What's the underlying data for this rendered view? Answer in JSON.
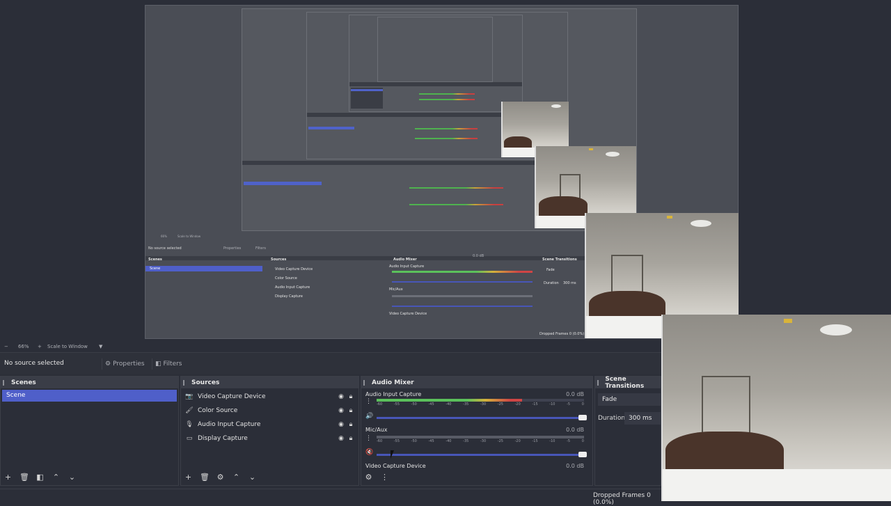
{
  "preview": {
    "nested_labels": {
      "no_source": "No source selected",
      "properties": "Properties",
      "filters": "Filters",
      "scenes": "Scenes",
      "scene": "Scene",
      "sources": "Sources",
      "mixer": "Audio Mixer",
      "transitions": "Scene Transitions",
      "zoom": "66%",
      "scale": "Scale to Window",
      "fade": "Fade",
      "duration": "Duration",
      "duration_val": "300 ms",
      "frames": "Dropped Frames 0 (0.0%)",
      "src1": "Video Capture Device",
      "src2": "Color Source",
      "src3": "Audio Input Capture",
      "src4": "Display Capture",
      "aic": "Audio Input Capture",
      "mic": "Mic/Aux",
      "vcd": "Video Capture Device",
      "db": "0.0 dB"
    }
  },
  "toolbar": {
    "zoom_minus": "−",
    "zoom_value": "66%",
    "zoom_plus": "+",
    "scale_mode": "Scale to Window"
  },
  "context": {
    "no_source": "No source selected",
    "properties": "Properties",
    "filters": "Filters"
  },
  "scenes": {
    "title": "Scenes",
    "items": [
      "Scene"
    ]
  },
  "sources": {
    "title": "Sources",
    "items": [
      {
        "label": "Video Capture Device",
        "icon": "camera-icon"
      },
      {
        "label": "Color Source",
        "icon": "paint-brush-icon"
      },
      {
        "label": "Audio Input Capture",
        "icon": "microphone-icon"
      },
      {
        "label": "Display Capture",
        "icon": "monitor-icon"
      }
    ]
  },
  "mixer": {
    "title": "Audio Mixer",
    "channels": [
      {
        "name": "Audio Input Capture",
        "db": "0.0 dB",
        "level": 0.7
      },
      {
        "name": "Mic/Aux",
        "db": "0.0 dB",
        "level": 0.0
      },
      {
        "name": "Video Capture Device",
        "db": "0.0 dB"
      }
    ],
    "ticks": [
      "-60",
      "-55",
      "-50",
      "-45",
      "-40",
      "-35",
      "-30",
      "-25",
      "-20",
      "-15",
      "-10",
      "-5",
      "0"
    ]
  },
  "transitions": {
    "title": "Scene Transitions",
    "type": "Fade",
    "duration_label": "Duration",
    "duration_value": "300 ms"
  },
  "status": {
    "dropped_frames": "Dropped Frames 0 (0.0%)"
  },
  "colors": {
    "accent": "#4f5fc9",
    "meter_green": "#5bc05b",
    "meter_yellow": "#d4b13c",
    "meter_red": "#cf4545"
  }
}
